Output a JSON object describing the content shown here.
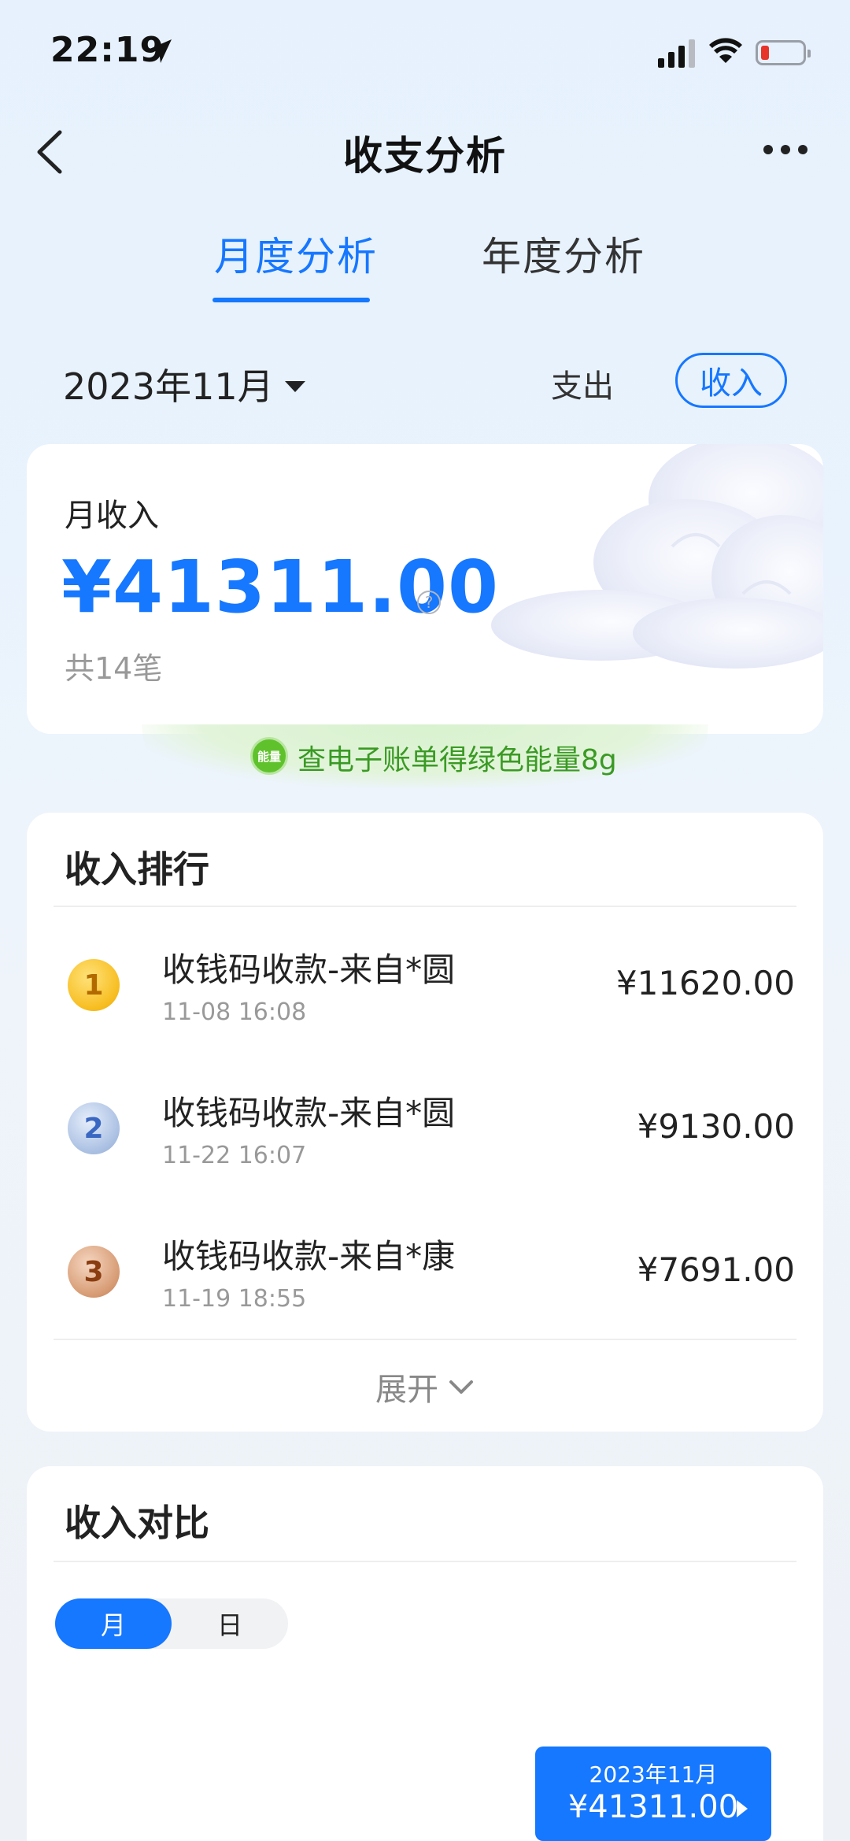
{
  "status_bar": {
    "time": "22:19"
  },
  "nav": {
    "title": "收支分析"
  },
  "tabs": [
    {
      "label": "月度分析",
      "active": true
    },
    {
      "label": "年度分析",
      "active": false
    }
  ],
  "filter": {
    "month": "2023年11月",
    "expense_label": "支出",
    "income_label": "收入",
    "selected": "收入"
  },
  "summary": {
    "label": "月收入",
    "amount": "¥41311.00",
    "help": "?",
    "count": "共14笔"
  },
  "energy": {
    "badge": "能量",
    "text": "查电子账单得绿色能量8g"
  },
  "ranking": {
    "title": "收入排行",
    "items": [
      {
        "rank": "1",
        "title": "收钱码收款-来自*圆",
        "time": "11-08 16:08",
        "amount": "¥11620.00"
      },
      {
        "rank": "2",
        "title": "收钱码收款-来自*圆",
        "time": "11-22 16:07",
        "amount": "¥9130.00"
      },
      {
        "rank": "3",
        "title": "收钱码收款-来自*康",
        "time": "11-19 18:55",
        "amount": "¥7691.00"
      }
    ],
    "expand_label": "展开"
  },
  "compare": {
    "title": "收入对比",
    "segments": {
      "month": "月",
      "day": "日"
    },
    "tooltip": {
      "month": "2023年11月",
      "amount": "¥41311.00"
    }
  },
  "colors": {
    "accent": "#1677ff",
    "energy_green": "#3a9a24"
  }
}
